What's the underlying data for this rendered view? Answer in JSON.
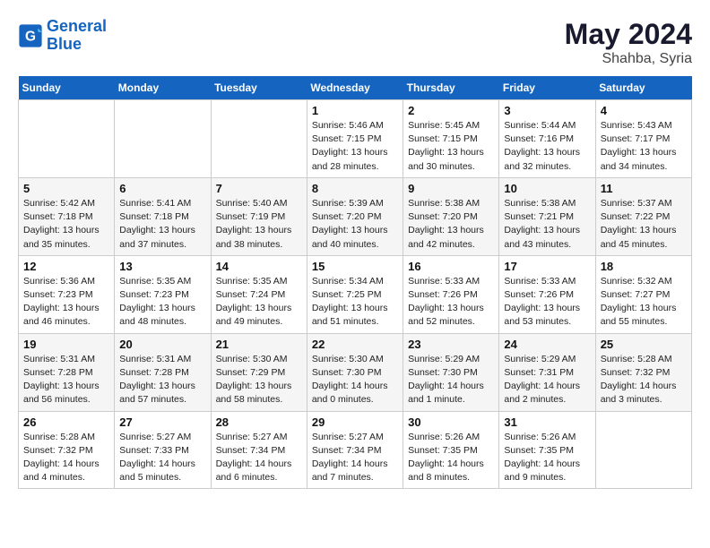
{
  "logo": {
    "line1": "General",
    "line2": "Blue"
  },
  "title": "May 2024",
  "location": "Shahba, Syria",
  "days_of_week": [
    "Sunday",
    "Monday",
    "Tuesday",
    "Wednesday",
    "Thursday",
    "Friday",
    "Saturday"
  ],
  "weeks": [
    [
      {
        "day": "",
        "info": ""
      },
      {
        "day": "",
        "info": ""
      },
      {
        "day": "",
        "info": ""
      },
      {
        "day": "1",
        "info": "Sunrise: 5:46 AM\nSunset: 7:15 PM\nDaylight: 13 hours\nand 28 minutes."
      },
      {
        "day": "2",
        "info": "Sunrise: 5:45 AM\nSunset: 7:15 PM\nDaylight: 13 hours\nand 30 minutes."
      },
      {
        "day": "3",
        "info": "Sunrise: 5:44 AM\nSunset: 7:16 PM\nDaylight: 13 hours\nand 32 minutes."
      },
      {
        "day": "4",
        "info": "Sunrise: 5:43 AM\nSunset: 7:17 PM\nDaylight: 13 hours\nand 34 minutes."
      }
    ],
    [
      {
        "day": "5",
        "info": "Sunrise: 5:42 AM\nSunset: 7:18 PM\nDaylight: 13 hours\nand 35 minutes."
      },
      {
        "day": "6",
        "info": "Sunrise: 5:41 AM\nSunset: 7:18 PM\nDaylight: 13 hours\nand 37 minutes."
      },
      {
        "day": "7",
        "info": "Sunrise: 5:40 AM\nSunset: 7:19 PM\nDaylight: 13 hours\nand 38 minutes."
      },
      {
        "day": "8",
        "info": "Sunrise: 5:39 AM\nSunset: 7:20 PM\nDaylight: 13 hours\nand 40 minutes."
      },
      {
        "day": "9",
        "info": "Sunrise: 5:38 AM\nSunset: 7:20 PM\nDaylight: 13 hours\nand 42 minutes."
      },
      {
        "day": "10",
        "info": "Sunrise: 5:38 AM\nSunset: 7:21 PM\nDaylight: 13 hours\nand 43 minutes."
      },
      {
        "day": "11",
        "info": "Sunrise: 5:37 AM\nSunset: 7:22 PM\nDaylight: 13 hours\nand 45 minutes."
      }
    ],
    [
      {
        "day": "12",
        "info": "Sunrise: 5:36 AM\nSunset: 7:23 PM\nDaylight: 13 hours\nand 46 minutes."
      },
      {
        "day": "13",
        "info": "Sunrise: 5:35 AM\nSunset: 7:23 PM\nDaylight: 13 hours\nand 48 minutes."
      },
      {
        "day": "14",
        "info": "Sunrise: 5:35 AM\nSunset: 7:24 PM\nDaylight: 13 hours\nand 49 minutes."
      },
      {
        "day": "15",
        "info": "Sunrise: 5:34 AM\nSunset: 7:25 PM\nDaylight: 13 hours\nand 51 minutes."
      },
      {
        "day": "16",
        "info": "Sunrise: 5:33 AM\nSunset: 7:26 PM\nDaylight: 13 hours\nand 52 minutes."
      },
      {
        "day": "17",
        "info": "Sunrise: 5:33 AM\nSunset: 7:26 PM\nDaylight: 13 hours\nand 53 minutes."
      },
      {
        "day": "18",
        "info": "Sunrise: 5:32 AM\nSunset: 7:27 PM\nDaylight: 13 hours\nand 55 minutes."
      }
    ],
    [
      {
        "day": "19",
        "info": "Sunrise: 5:31 AM\nSunset: 7:28 PM\nDaylight: 13 hours\nand 56 minutes."
      },
      {
        "day": "20",
        "info": "Sunrise: 5:31 AM\nSunset: 7:28 PM\nDaylight: 13 hours\nand 57 minutes."
      },
      {
        "day": "21",
        "info": "Sunrise: 5:30 AM\nSunset: 7:29 PM\nDaylight: 13 hours\nand 58 minutes."
      },
      {
        "day": "22",
        "info": "Sunrise: 5:30 AM\nSunset: 7:30 PM\nDaylight: 14 hours\nand 0 minutes."
      },
      {
        "day": "23",
        "info": "Sunrise: 5:29 AM\nSunset: 7:30 PM\nDaylight: 14 hours\nand 1 minute."
      },
      {
        "day": "24",
        "info": "Sunrise: 5:29 AM\nSunset: 7:31 PM\nDaylight: 14 hours\nand 2 minutes."
      },
      {
        "day": "25",
        "info": "Sunrise: 5:28 AM\nSunset: 7:32 PM\nDaylight: 14 hours\nand 3 minutes."
      }
    ],
    [
      {
        "day": "26",
        "info": "Sunrise: 5:28 AM\nSunset: 7:32 PM\nDaylight: 14 hours\nand 4 minutes."
      },
      {
        "day": "27",
        "info": "Sunrise: 5:27 AM\nSunset: 7:33 PM\nDaylight: 14 hours\nand 5 minutes."
      },
      {
        "day": "28",
        "info": "Sunrise: 5:27 AM\nSunset: 7:34 PM\nDaylight: 14 hours\nand 6 minutes."
      },
      {
        "day": "29",
        "info": "Sunrise: 5:27 AM\nSunset: 7:34 PM\nDaylight: 14 hours\nand 7 minutes."
      },
      {
        "day": "30",
        "info": "Sunrise: 5:26 AM\nSunset: 7:35 PM\nDaylight: 14 hours\nand 8 minutes."
      },
      {
        "day": "31",
        "info": "Sunrise: 5:26 AM\nSunset: 7:35 PM\nDaylight: 14 hours\nand 9 minutes."
      },
      {
        "day": "",
        "info": ""
      }
    ]
  ]
}
